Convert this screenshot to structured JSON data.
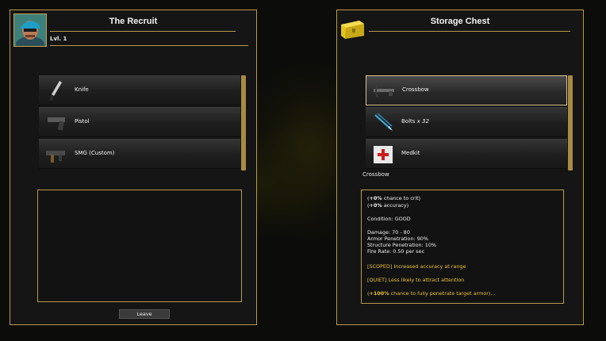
{
  "recruit": {
    "title": "The Recruit",
    "level": "Lvl. 1",
    "inventory": [
      {
        "name": "Knife",
        "icon": "knife-icon"
      },
      {
        "name": "Pistol",
        "icon": "pistol-icon"
      },
      {
        "name": "SMG (Custom)",
        "icon": "smg-icon"
      }
    ],
    "leave_label": "Leave"
  },
  "storage": {
    "title": "Storage Chest",
    "items": [
      {
        "name": "Crossbow",
        "icon": "crossbow-icon",
        "selected": true
      },
      {
        "name": "Bolts",
        "qty": "x 32",
        "icon": "bolts-icon"
      },
      {
        "name": "Medkit",
        "icon": "medkit-icon"
      }
    ],
    "selected_item": "Crossbow",
    "details": {
      "crit_value": "+0%",
      "crit_text": " chance to crit)",
      "acc_value": "+0%",
      "acc_text": " accuracy)",
      "condition": "Condition: GOOD",
      "damage": "Damage: 70 - 80",
      "armor_pen": "Armor Penetration: 90%",
      "struct_pen": "Structure Penetration: 10%",
      "fire_rate": "Fire Rate: 0.50 per sec",
      "trait_scoped": "[SCOPED] Increased accuracy at range",
      "trait_quiet": "[QUIET] Less likely to attract attention",
      "trait_pen_value": "+100%",
      "trait_pen_text": " chance to fully penetrate target armor)..."
    }
  },
  "colors": {
    "border_gold": "#b89a4a",
    "trait_gold": "#e8c23a",
    "panel_bg": "#151515"
  }
}
